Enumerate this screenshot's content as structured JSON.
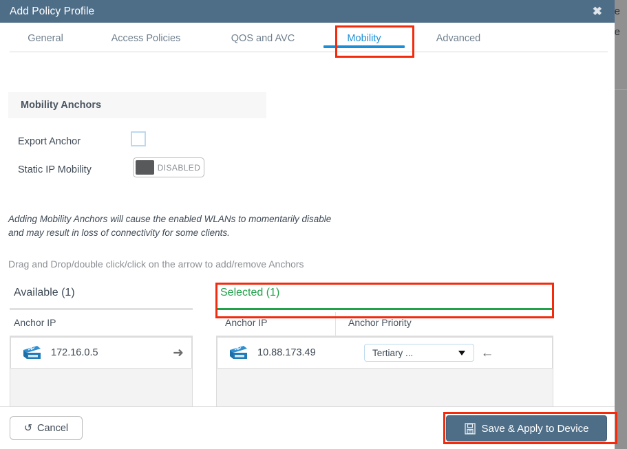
{
  "background": {
    "edge_text_1": "e",
    "edge_text_2": "e"
  },
  "dialog": {
    "title": "Add Policy Profile",
    "close_label": "✖",
    "titlebar_color": "#4e6e88"
  },
  "tabs": {
    "items": [
      {
        "label": "General",
        "active": false
      },
      {
        "label": "Access Policies",
        "active": false
      },
      {
        "label": "QOS and AVC",
        "active": false
      },
      {
        "label": "Mobility",
        "active": true
      },
      {
        "label": "Advanced",
        "active": false
      }
    ],
    "active_color": "#1a8fd8",
    "inactive_color": "#6f7f8d"
  },
  "mobility": {
    "section_title": "Mobility Anchors",
    "export_anchor": {
      "label": "Export Anchor",
      "checked": false
    },
    "static_ip_mobility": {
      "label": "Static IP Mobility",
      "state": "DISABLED"
    },
    "warning_text": "Adding Mobility Anchors will cause the enabled WLANs to momentarily disable and may result in loss of connectivity for some clients.",
    "hint_text": "Drag and Drop/double click/click on the arrow to add/remove Anchors"
  },
  "available_panel": {
    "title": "Available (1)",
    "column_headers": [
      "Anchor IP"
    ],
    "rows": [
      {
        "icon": "network-switch-icon",
        "ip": "172.16.0.5",
        "action_icon": "arrow-right-icon",
        "action_glyph": "➜"
      }
    ]
  },
  "selected_panel": {
    "title": "Selected (1)",
    "title_color": "#22a14a",
    "column_headers": [
      "Anchor IP",
      "Anchor Priority"
    ],
    "rows": [
      {
        "icon": "network-switch-icon",
        "ip": "10.88.173.49",
        "priority": "Tertiary ...",
        "action_icon": "arrow-left-icon",
        "action_glyph": "←"
      }
    ]
  },
  "footer": {
    "cancel_label": "Cancel",
    "cancel_icon": "undo-arrow-icon",
    "cancel_glyph": "↺",
    "save_label": "Save & Apply to Device",
    "save_icon": "floppy-disk-save-icon"
  },
  "annotations": {
    "highlight_color": "#f42a0c",
    "boxes": [
      "mobility-tab",
      "selected-anchor-row",
      "save-apply-button"
    ]
  }
}
